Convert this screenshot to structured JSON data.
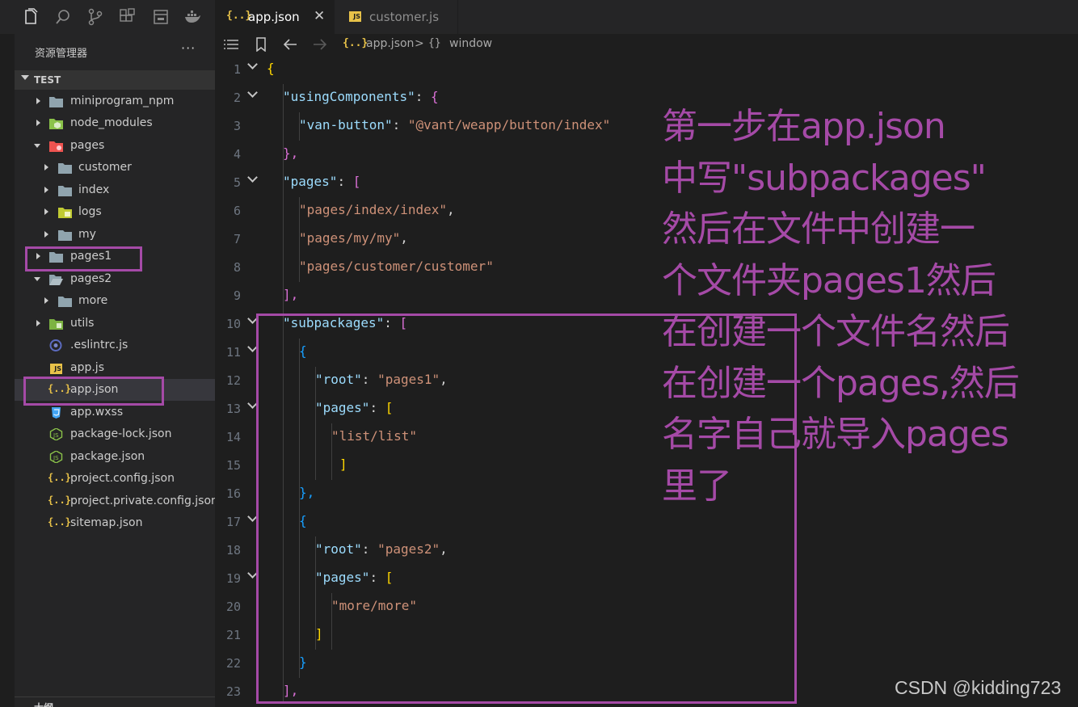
{
  "activity_bar": {
    "icons": [
      "files-icon",
      "search-icon",
      "source-control-icon",
      "extensions-icon",
      "window-icon",
      "docker-icon"
    ]
  },
  "explorer": {
    "title": "资源管理器",
    "more": "···",
    "root": "TEST",
    "items": [
      {
        "label": "miniprogram_npm",
        "kind": "folder"
      },
      {
        "label": "node_modules",
        "kind": "folder"
      },
      {
        "label": "pages",
        "kind": "folder"
      },
      {
        "label": "customer",
        "kind": "folder"
      },
      {
        "label": "index",
        "kind": "folder"
      },
      {
        "label": "logs",
        "kind": "folder"
      },
      {
        "label": "my",
        "kind": "folder"
      },
      {
        "label": "pages1",
        "kind": "folder"
      },
      {
        "label": "pages2",
        "kind": "folder"
      },
      {
        "label": "more",
        "kind": "folder"
      },
      {
        "label": "utils",
        "kind": "folder"
      },
      {
        "label": ".eslintrc.js",
        "kind": "file"
      },
      {
        "label": "app.js",
        "kind": "file"
      },
      {
        "label": "app.json",
        "kind": "file"
      },
      {
        "label": "app.wxss",
        "kind": "file"
      },
      {
        "label": "package-lock.json",
        "kind": "file"
      },
      {
        "label": "package.json",
        "kind": "file"
      },
      {
        "label": "project.config.json",
        "kind": "file"
      },
      {
        "label": "project.private.config.json",
        "kind": "file"
      },
      {
        "label": "sitemap.json",
        "kind": "file"
      }
    ],
    "outline_label": "大纲"
  },
  "tabs": [
    {
      "label": "app.json",
      "icon": "{..}",
      "active": true,
      "close": "✕"
    },
    {
      "label": "customer.js",
      "icon": "JS",
      "active": false
    }
  ],
  "breadcrumb": {
    "file_icon": "{..}",
    "file": "app.json",
    "separator": ">",
    "symbol_icon": "{}",
    "symbol": "window"
  },
  "json_icon": "{..}",
  "js_icon": "JS",
  "line_numbers": [
    "1",
    "2",
    "3",
    "4",
    "5",
    "6",
    "7",
    "8",
    "9",
    "10",
    "11",
    "12",
    "13",
    "14",
    "15",
    "16",
    "17",
    "18",
    "19",
    "20",
    "21",
    "22",
    "23"
  ],
  "code": {
    "l1": "{",
    "l2_key": "\"usingComponents\"",
    "l3_key": "\"van-button\"",
    "l3_val": "\"@vant/weapp/button/index\"",
    "l4": "},",
    "l5_key": "\"pages\"",
    "l6": "\"pages/index/index\"",
    "l7": "\"pages/my/my\"",
    "l8": "\"pages/customer/customer\"",
    "l9": "],",
    "l10_key": "\"subpackages\"",
    "l11": "{",
    "l12_key": "\"root\"",
    "l12_val": "\"pages1\"",
    "l13_key": "\"pages\"",
    "l14": "\"list/list\"",
    "l15": "]",
    "l16": "},",
    "l17": "{",
    "l18_key": "\"root\"",
    "l18_val": "\"pages2\"",
    "l19_key": "\"pages\"",
    "l20": "\"more/more\"",
    "l21": "]",
    "l22": "}",
    "l23": "],",
    "colon": ": ",
    "comma": ",",
    "open_brace": "{",
    "open_bracket": "["
  },
  "annotation": {
    "lines": [
      "第一步在app.json",
      "中写\"subpackages\"",
      "然后在文件中创建一",
      "个文件夹pages1然后",
      "在创建一个文件名然后",
      "在创建一个pages,然后",
      "名字自己就导入pages",
      "里了"
    ],
    "color": "#a54aa7"
  },
  "watermark": "CSDN @kidding723",
  "colors": {
    "editor_bg": "#1e1e1e",
    "sidebar_bg": "#252526",
    "key": "#9cdcfe",
    "string": "#ce9178",
    "highlight_box": "#a54aa7"
  }
}
